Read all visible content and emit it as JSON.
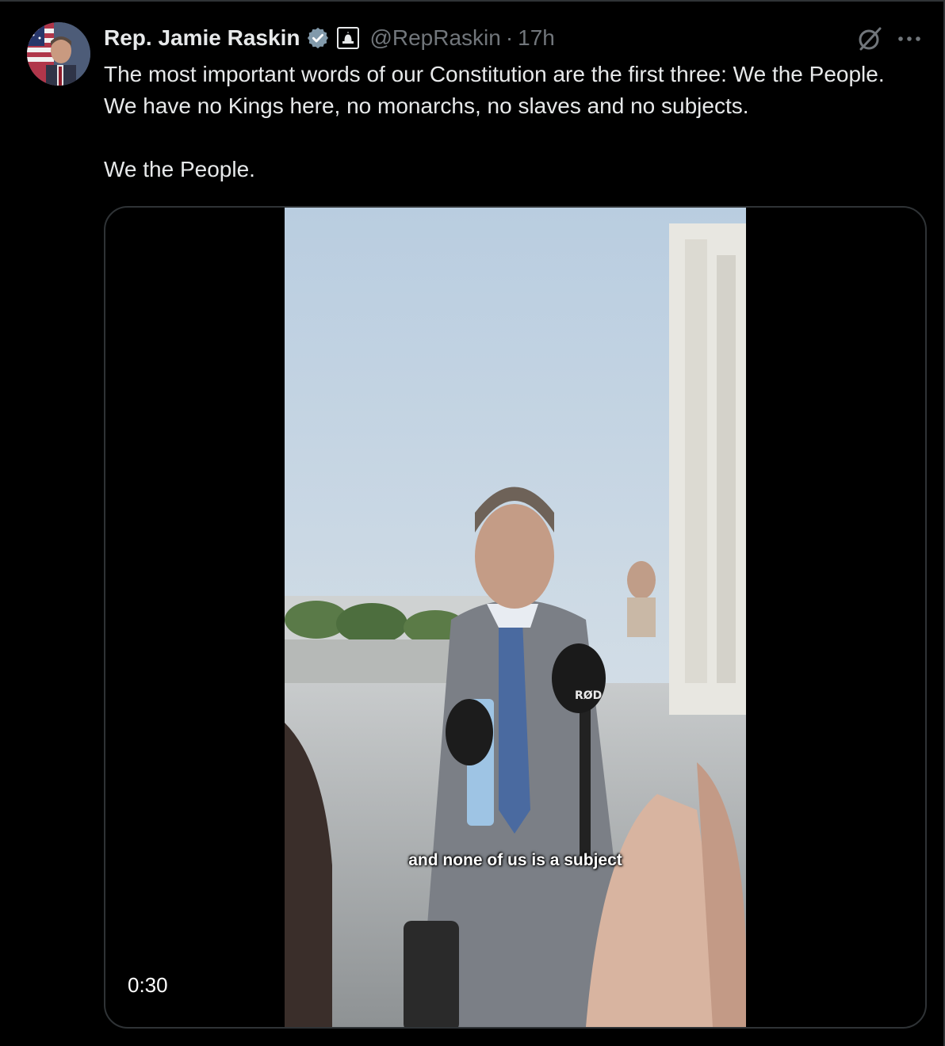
{
  "tweet": {
    "author": {
      "display_name": "Rep. Jamie Raskin",
      "handle": "@RepRaskin",
      "verified": true,
      "verified_color": "#829aab",
      "affiliation_icon": "capitol-dome-icon"
    },
    "dot": "·",
    "timestamp": "17h",
    "text_paragraphs": [
      "The most important words of our Constitution are the first three: We the People. We have no Kings here, no monarchs, no slaves and no subjects.",
      "We the People."
    ],
    "media": {
      "type": "video",
      "caption": "and none of us is a subject",
      "duration": "0:30",
      "mic_flag": "RØD"
    },
    "actions": {
      "grok_icon": "grok-icon",
      "more_icon": "more-dots-icon"
    }
  },
  "colors": {
    "background": "#000000",
    "text_primary": "#e7e9ea",
    "text_secondary": "#71767b",
    "border": "#2f3336"
  }
}
